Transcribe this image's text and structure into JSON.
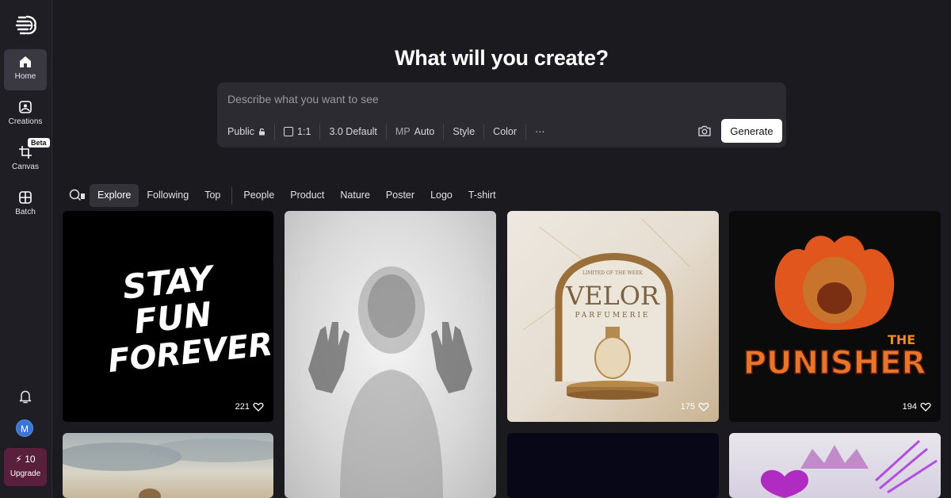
{
  "sidebar": {
    "items": [
      {
        "label": "Home",
        "icon": "home-icon"
      },
      {
        "label": "Creations",
        "icon": "image-icon"
      },
      {
        "label": "Canvas",
        "icon": "canvas-icon",
        "badge": "Beta"
      },
      {
        "label": "Batch",
        "icon": "batch-icon"
      }
    ],
    "avatar_initial": "M",
    "credits": "10",
    "upgrade_label": "Upgrade"
  },
  "main": {
    "heading": "What will you create?",
    "prompt": {
      "placeholder": "Describe what you want to see",
      "value": ""
    },
    "options": {
      "visibility": "Public",
      "aspect": "1:1",
      "model": "3.0 Default",
      "mp_label": "MP",
      "mp_value": "Auto",
      "style": "Style",
      "color": "Color",
      "more": "···"
    },
    "generate_label": "Generate",
    "tabs": [
      "Explore",
      "Following",
      "Top",
      "People",
      "Product",
      "Nature",
      "Poster",
      "Logo",
      "T-shirt"
    ],
    "active_tab": "Explore"
  },
  "gallery": [
    {
      "name": "stay-fun-forever",
      "likes": "221",
      "lines": [
        "STAY",
        "FUN",
        "FOREVER"
      ]
    },
    {
      "name": "ghost-woman",
      "likes": ""
    },
    {
      "name": "velor-perfume",
      "likes": "175",
      "small": "LIMITED OF THE WEEK",
      "brand": "VELOR",
      "sub": "PARFUMERIE"
    },
    {
      "name": "the-punisher",
      "likes": "194",
      "lines": [
        "THE",
        "PUNISHER"
      ]
    }
  ],
  "colors": {
    "background": "#1b1a1f",
    "sidebar": "#1f1e24",
    "panel": "#2c2b31",
    "upgrade": "#5a1f3a",
    "avatar": "#3b74d6"
  }
}
